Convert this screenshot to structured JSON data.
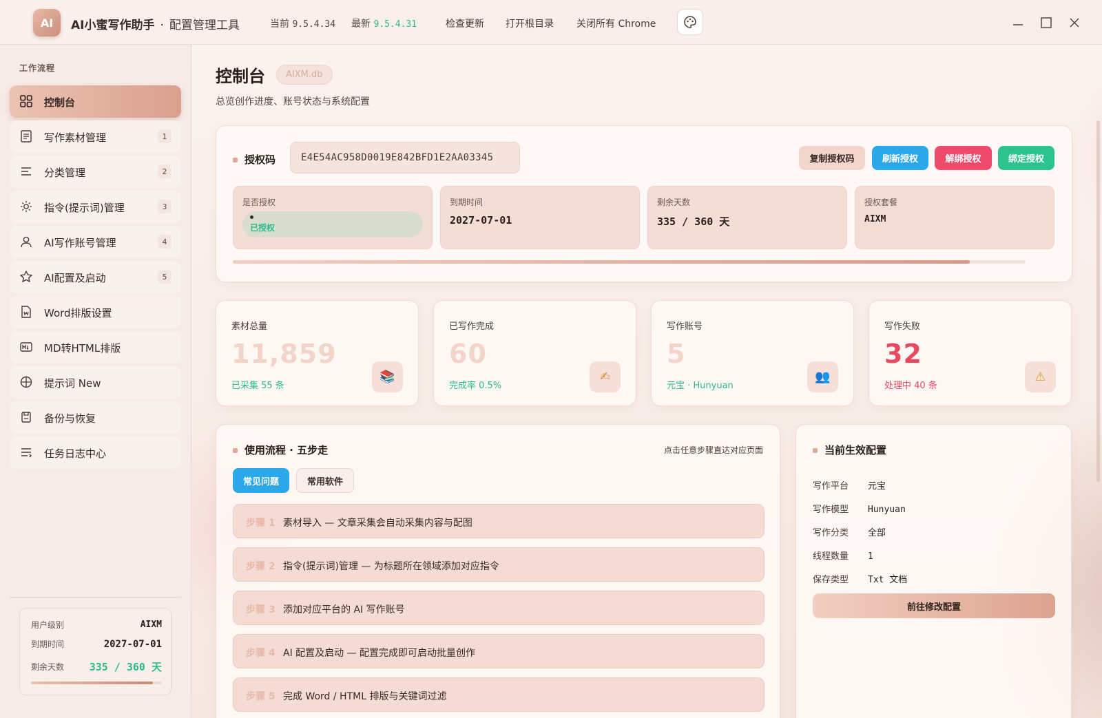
{
  "titlebar": {
    "logo": "AI",
    "app_name": "AI小蜜写作助手",
    "separator": "·",
    "app_sub": "配置管理工具",
    "current_label": "当前",
    "current_version": "9.5.4.34",
    "latest_label": "最新",
    "latest_version": "9.5.4.31",
    "check_update": "检查更新",
    "open_root": "打开根目录",
    "close_chrome": "关闭所有 Chrome"
  },
  "sidebar": {
    "section": "工作流程",
    "items": [
      {
        "label": "控制台",
        "badge": "",
        "icon": "dashboard-icon"
      },
      {
        "label": "写作素材管理",
        "badge": "1",
        "icon": "document-icon"
      },
      {
        "label": "分类管理",
        "badge": "2",
        "icon": "list-icon"
      },
      {
        "label": "指令(提示词)管理",
        "badge": "3",
        "icon": "sun-icon"
      },
      {
        "label": "AI写作账号管理",
        "badge": "4",
        "icon": "user-icon"
      },
      {
        "label": "AI配置及启动",
        "badge": "5",
        "icon": "star-icon"
      },
      {
        "label": "Word排版设置",
        "badge": "",
        "icon": "word-file-icon"
      },
      {
        "label": "MD转HTML排版",
        "badge": "",
        "icon": "markdown-icon"
      },
      {
        "label": "提示词 New",
        "badge": "",
        "icon": "globe-icon"
      },
      {
        "label": "备份与恢复",
        "badge": "",
        "icon": "backup-icon"
      },
      {
        "label": "任务日志中心",
        "badge": "",
        "icon": "log-icon"
      }
    ],
    "user_card": {
      "level_label": "用户级别",
      "level": "AIXM",
      "expire_label": "到期时间",
      "expire": "2027-07-01",
      "days_label": "剩余天数",
      "days": "335 / 360 天",
      "days_fraction": 0.93
    }
  },
  "header": {
    "title": "控制台",
    "db": "AIXM.db",
    "subtitle": "总览创作进度、账号状态与系统配置"
  },
  "license": {
    "label": "授权码",
    "code": "E4E54AC958D0019E842BFD1E2AA03345",
    "buttons": {
      "copy": "复制授权码",
      "refresh": "刷新授权",
      "unbind": "解绑授权",
      "bind": "绑定授权"
    },
    "boxes": [
      {
        "k": "是否授权",
        "v": "已授权"
      },
      {
        "k": "到期时间",
        "v": "2027-07-01"
      },
      {
        "k": "剩余天数",
        "v": "335 / 360 天"
      },
      {
        "k": "授权套餐",
        "v": "AIXM"
      }
    ],
    "progress_fraction": 0.93
  },
  "stats": [
    {
      "k": "素材总量",
      "big": "11,859",
      "hint": "已采集 55 条",
      "icon": "books-icon",
      "glyph": "📚"
    },
    {
      "k": "已写作完成",
      "big": "60",
      "hint": "完成率 0.5%",
      "icon": "writing-hand-icon",
      "glyph": "✍"
    },
    {
      "k": "写作账号",
      "big": "5",
      "hint": "元宝 · Hunyuan",
      "icon": "users-icon",
      "glyph": "👥"
    },
    {
      "k": "写作失败",
      "big": "32",
      "hint": "处理中 40 条",
      "icon": "warning-icon",
      "glyph": "⚠"
    }
  ],
  "flow": {
    "title": "使用流程 · 五步走",
    "hint": "点击任意步骤直达对应页面",
    "tabs": [
      "常见问题",
      "常用软件"
    ],
    "steps": [
      {
        "n": "步骤 1",
        "t": "素材导入 — 文章采集会自动采集内容与配图"
      },
      {
        "n": "步骤 2",
        "t": "指令(提示词)管理 — 为标题所在领域添加对应指令"
      },
      {
        "n": "步骤 3",
        "t": "添加对应平台的 AI 写作账号"
      },
      {
        "n": "步骤 4",
        "t": "AI 配置及启动 — 配置完成即可启动批量创作"
      },
      {
        "n": "步骤 5",
        "t": "完成 Word / HTML 排版与关键词过滤"
      }
    ]
  },
  "config": {
    "title": "当前生效配置",
    "rows": [
      {
        "k": "写作平台",
        "v": "元宝"
      },
      {
        "k": "写作模型",
        "v": "Hunyuan"
      },
      {
        "k": "写作分类",
        "v": "全部"
      },
      {
        "k": "线程数量",
        "v": "1"
      },
      {
        "k": "保存类型",
        "v": "Txt 文档"
      }
    ],
    "button": "前往修改配置"
  },
  "colors": {
    "accent": "#d9a08d",
    "blue": "#2aa8ea",
    "red": "#ef4a6c",
    "green": "#2bc48e"
  }
}
